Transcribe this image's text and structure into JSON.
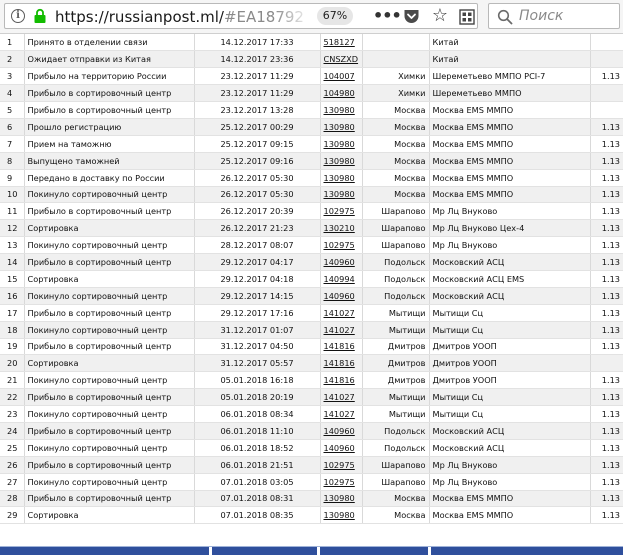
{
  "browser": {
    "url_host": "https://russianpost.ml/",
    "url_rest": "#EA18792",
    "zoom": "67%",
    "search_placeholder": "Поиск"
  },
  "tracking": {
    "rows": [
      {
        "n": "1",
        "status": "Принято в отделении связи",
        "date": "14.12.2017 17:33",
        "index": "518127",
        "city": "",
        "office": "Китай",
        "weight": ""
      },
      {
        "n": "2",
        "status": "Ожидает отправки из Китая",
        "date": "14.12.2017 23:36",
        "index": "CNSZXD",
        "city": "",
        "office": "Китай",
        "weight": ""
      },
      {
        "n": "3",
        "status": "Прибыло на территорию России",
        "date": "23.12.2017 11:29",
        "index": "104007",
        "city": "Химки",
        "office": "Шереметьево ММПО PCI-7",
        "weight": "1.13"
      },
      {
        "n": "4",
        "status": "Прибыло в сортировочный центр",
        "date": "23.12.2017 11:29",
        "index": "104980",
        "city": "Химки",
        "office": "Шереметьево ММПО",
        "weight": ""
      },
      {
        "n": "5",
        "status": "Прибыло в сортировочный центр",
        "date": "23.12.2017 13:28",
        "index": "130980",
        "city": "Москва",
        "office": "Москва EMS ММПО",
        "weight": ""
      },
      {
        "n": "6",
        "status": "Прошло регистрацию",
        "date": "25.12.2017 00:29",
        "index": "130980",
        "city": "Москва",
        "office": "Москва EMS ММПО",
        "weight": "1.13"
      },
      {
        "n": "7",
        "status": "Прием на таможню",
        "date": "25.12.2017 09:15",
        "index": "130980",
        "city": "Москва",
        "office": "Москва EMS ММПО",
        "weight": "1.13"
      },
      {
        "n": "8",
        "status": "Выпущено таможней",
        "date": "25.12.2017 09:16",
        "index": "130980",
        "city": "Москва",
        "office": "Москва EMS ММПО",
        "weight": "1.13"
      },
      {
        "n": "9",
        "status": "Передано в доставку по России",
        "date": "26.12.2017 05:30",
        "index": "130980",
        "city": "Москва",
        "office": "Москва EMS ММПО",
        "weight": "1.13"
      },
      {
        "n": "10",
        "status": "Покинуло сортировочный центр",
        "date": "26.12.2017 05:30",
        "index": "130980",
        "city": "Москва",
        "office": "Москва EMS ММПО",
        "weight": "1.13"
      },
      {
        "n": "11",
        "status": "Прибыло в сортировочный центр",
        "date": "26.12.2017 20:39",
        "index": "102975",
        "city": "Шарапово",
        "office": "Мр Лц Внуково",
        "weight": "1.13"
      },
      {
        "n": "12",
        "status": "Сортировка",
        "date": "26.12.2017 21:23",
        "index": "130210",
        "city": "Шарапово",
        "office": "Мр Лц Внуково Цех-4",
        "weight": "1.13"
      },
      {
        "n": "13",
        "status": "Покинуло сортировочный центр",
        "date": "28.12.2017 08:07",
        "index": "102975",
        "city": "Шарапово",
        "office": "Мр Лц Внуково",
        "weight": "1.13"
      },
      {
        "n": "14",
        "status": "Прибыло в сортировочный центр",
        "date": "29.12.2017 04:17",
        "index": "140960",
        "city": "Подольск",
        "office": "Московский АСЦ",
        "weight": "1.13"
      },
      {
        "n": "15",
        "status": "Сортировка",
        "date": "29.12.2017 04:18",
        "index": "140994",
        "city": "Подольск",
        "office": "Московский АСЦ EMS",
        "weight": "1.13"
      },
      {
        "n": "16",
        "status": "Покинуло сортировочный центр",
        "date": "29.12.2017 14:15",
        "index": "140960",
        "city": "Подольск",
        "office": "Московский АСЦ",
        "weight": "1.13"
      },
      {
        "n": "17",
        "status": "Прибыло в сортировочный центр",
        "date": "29.12.2017 17:16",
        "index": "141027",
        "city": "Мытищи",
        "office": "Мытищи Сц",
        "weight": "1.13"
      },
      {
        "n": "18",
        "status": "Покинуло сортировочный центр",
        "date": "31.12.2017 01:07",
        "index": "141027",
        "city": "Мытищи",
        "office": "Мытищи Сц",
        "weight": "1.13"
      },
      {
        "n": "19",
        "status": "Прибыло в сортировочный центр",
        "date": "31.12.2017 04:50",
        "index": "141816",
        "city": "Дмитров",
        "office": "Дмитров УООП",
        "weight": "1.13"
      },
      {
        "n": "20",
        "status": "Сортировка",
        "date": "31.12.2017 05:57",
        "index": "141816",
        "city": "Дмитров",
        "office": "Дмитров УООП",
        "weight": ""
      },
      {
        "n": "21",
        "status": "Покинуло сортировочный центр",
        "date": "05.01.2018 16:18",
        "index": "141816",
        "city": "Дмитров",
        "office": "Дмитров УООП",
        "weight": "1.13"
      },
      {
        "n": "22",
        "status": "Прибыло в сортировочный центр",
        "date": "05.01.2018 20:19",
        "index": "141027",
        "city": "Мытищи",
        "office": "Мытищи Сц",
        "weight": "1.13"
      },
      {
        "n": "23",
        "status": "Покинуло сортировочный центр",
        "date": "06.01.2018 08:34",
        "index": "141027",
        "city": "Мытищи",
        "office": "Мытищи Сц",
        "weight": "1.13"
      },
      {
        "n": "24",
        "status": "Прибыло в сортировочный центр",
        "date": "06.01.2018 11:10",
        "index": "140960",
        "city": "Подольск",
        "office": "Московский АСЦ",
        "weight": "1.13"
      },
      {
        "n": "25",
        "status": "Покинуло сортировочный центр",
        "date": "06.01.2018 18:52",
        "index": "140960",
        "city": "Подольск",
        "office": "Московский АСЦ",
        "weight": "1.13"
      },
      {
        "n": "26",
        "status": "Прибыло в сортировочный центр",
        "date": "06.01.2018 21:51",
        "index": "102975",
        "city": "Шарапово",
        "office": "Мр Лц Внуково",
        "weight": "1.13"
      },
      {
        "n": "27",
        "status": "Покинуло сортировочный центр",
        "date": "07.01.2018 03:05",
        "index": "102975",
        "city": "Шарапово",
        "office": "Мр Лц Внуково",
        "weight": "1.13"
      },
      {
        "n": "28",
        "status": "Прибыло в сортировочный центр",
        "date": "07.01.2018 08:31",
        "index": "130980",
        "city": "Москва",
        "office": "Москва EMS ММПО",
        "weight": "1.13"
      },
      {
        "n": "29",
        "status": "Сортировка",
        "date": "07.01.2018 08:35",
        "index": "130980",
        "city": "Москва",
        "office": "Москва EMS ММПО",
        "weight": "1.13"
      }
    ]
  }
}
